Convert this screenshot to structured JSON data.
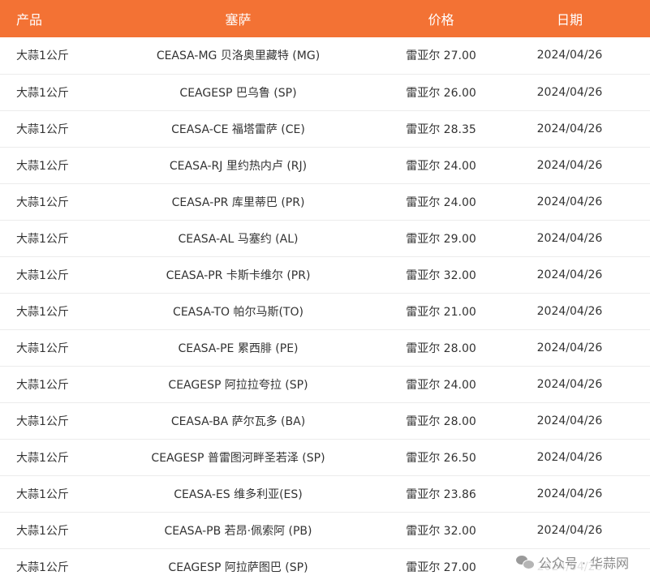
{
  "header": {
    "product": "产品",
    "ceasa": "塞萨",
    "price": "价格",
    "date": "日期"
  },
  "rows": [
    {
      "product": "大蒜1公斤",
      "ceasa": "CEASA-MG 贝洛奥里藏特 (MG)",
      "price": "雷亚尔 27.00",
      "date": "2024/04/26"
    },
    {
      "product": "大蒜1公斤",
      "ceasa": "CEAGESP 巴乌鲁 (SP)",
      "price": "雷亚尔 26.00",
      "date": "2024/04/26"
    },
    {
      "product": "大蒜1公斤",
      "ceasa": "CEASA-CE 福塔雷萨 (CE)",
      "price": "雷亚尔 28.35",
      "date": "2024/04/26"
    },
    {
      "product": "大蒜1公斤",
      "ceasa": "CEASA-RJ 里约热内卢 (RJ)",
      "price": "雷亚尔 24.00",
      "date": "2024/04/26"
    },
    {
      "product": "大蒜1公斤",
      "ceasa": "CEASA-PR 库里蒂巴 (PR)",
      "price": "雷亚尔 24.00",
      "date": "2024/04/26"
    },
    {
      "product": "大蒜1公斤",
      "ceasa": "CEASA-AL 马塞约 (AL)",
      "price": "雷亚尔 29.00",
      "date": "2024/04/26"
    },
    {
      "product": "大蒜1公斤",
      "ceasa": "CEASA-PR 卡斯卡维尔 (PR)",
      "price": "雷亚尔 32.00",
      "date": "2024/04/26"
    },
    {
      "product": "大蒜1公斤",
      "ceasa": "CEASA-TO 帕尔马斯(TO)",
      "price": "雷亚尔 21.00",
      "date": "2024/04/26"
    },
    {
      "product": "大蒜1公斤",
      "ceasa": "CEASA-PE 累西腓 (PE)",
      "price": "雷亚尔 28.00",
      "date": "2024/04/26"
    },
    {
      "product": "大蒜1公斤",
      "ceasa": "CEAGESP 阿拉拉夸拉 (SP)",
      "price": "雷亚尔 24.00",
      "date": "2024/04/26"
    },
    {
      "product": "大蒜1公斤",
      "ceasa": "CEASA-BA 萨尔瓦多 (BA)",
      "price": "雷亚尔 28.00",
      "date": "2024/04/26"
    },
    {
      "product": "大蒜1公斤",
      "ceasa": "CEAGESP 普雷图河畔圣若泽 (SP)",
      "price": "雷亚尔 26.50",
      "date": "2024/04/26"
    },
    {
      "product": "大蒜1公斤",
      "ceasa": "CEASA-ES 维多利亚(ES)",
      "price": "雷亚尔 23.86",
      "date": "2024/04/26"
    },
    {
      "product": "大蒜1公斤",
      "ceasa": "CEASA-PB 若昂·佩索阿 (PB)",
      "price": "雷亚尔 32.00",
      "date": "2024/04/26"
    },
    {
      "product": "大蒜1公斤",
      "ceasa": "CEAGESP 阿拉萨图巴 (SP)",
      "price": "雷亚尔 27.00",
      "date": "2024/04/26"
    }
  ],
  "watermark": {
    "text": "公众号 · 华蒜网",
    "icon": "wechat-icon"
  },
  "colors": {
    "header_bg": "#f37234",
    "header_text": "#ffffff",
    "row_text": "#333333"
  }
}
